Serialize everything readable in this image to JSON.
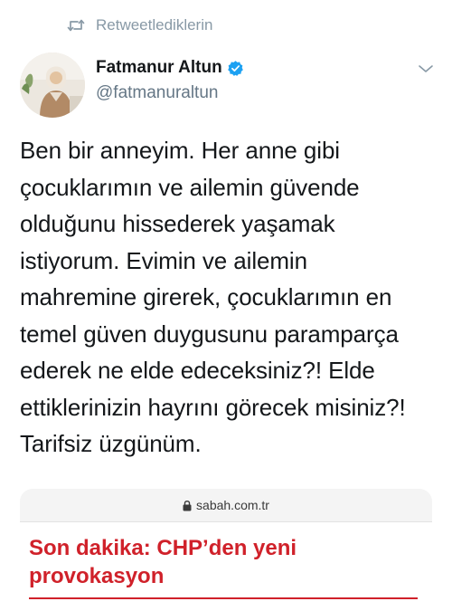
{
  "retweet": {
    "label": "Retweetlediklerin",
    "icon": "retweet-icon"
  },
  "author": {
    "name": "Fatmanur Altun",
    "handle": "@fatmanuraltun",
    "verified": true,
    "avatar": "profile-photo"
  },
  "tweet": {
    "lines": [
      "Ben bir anneyim. Her anne gibi",
      "çocuklarımın ve ailemin güvende",
      "olduğunu hissederek yaşamak",
      "istiyorum. Evimin ve ailemin",
      "mahremine girerek, çocuklarımın en",
      "temel güven duygusunu paramparça",
      "ederek ne elde edeceksiniz?! Elde",
      "ettiklerinizin hayrını görecek misiniz?!",
      "Tarifsiz üzgünüm."
    ]
  },
  "embed": {
    "url": "sabah.com.tr",
    "headline_lines": [
      "Son dakika: CHP’den yeni",
      "provokasyon"
    ]
  },
  "colors": {
    "verified_blue": "#1da1f2",
    "headline_red": "#d0212a",
    "muted_gray": "#8899a6"
  }
}
